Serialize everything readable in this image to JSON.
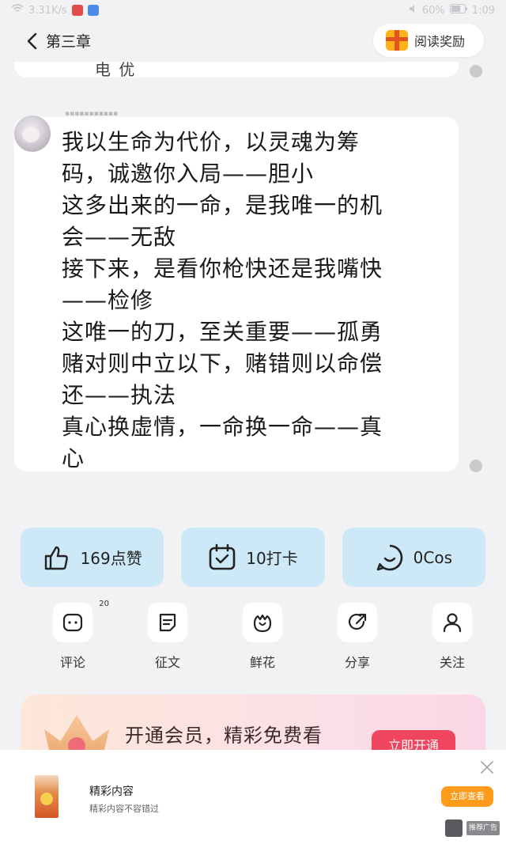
{
  "status_bar": {
    "net_speed": "3.31K/s",
    "battery": "60%",
    "time": "1:09"
  },
  "header": {
    "back_title": "第三章",
    "reward_label": "阅读奖励"
  },
  "previous_card": {
    "fragment": "电 优"
  },
  "comment": {
    "lines": [
      "我以生命为代价，以灵魂为筹",
      "码，诚邀你入局——胆小",
      "这多出来的一命，是我唯一的机",
      "会——无敌",
      "接下来，是看你枪快还是我嘴快",
      "——检修",
      "这唯一的刀，至关重要——孤勇",
      "赌对则中立以下，赌错则以命偿",
      "还——执法",
      "真心换虚情，一命换一命——真",
      "心"
    ]
  },
  "stats": {
    "likes": "169点赞",
    "checkins": "10打卡",
    "cos": "0Cos"
  },
  "actions": {
    "comment": "评论",
    "comment_count": "20",
    "contest": "征文",
    "flower": "鲜花",
    "share": "分享",
    "follow": "关注"
  },
  "vip": {
    "text": "开通会员，精彩免费看",
    "button": "立即开通"
  },
  "ad": {
    "title": "精彩内容",
    "subtitle": "精彩内容不容错过",
    "button": "立即查看",
    "tag": "推荐广告"
  },
  "colors": {
    "stat_bg": "#cde9f7",
    "vip_button": "#f0455e",
    "ad_button": "#ff9b1a",
    "page_bg": "#f2f2f4"
  }
}
